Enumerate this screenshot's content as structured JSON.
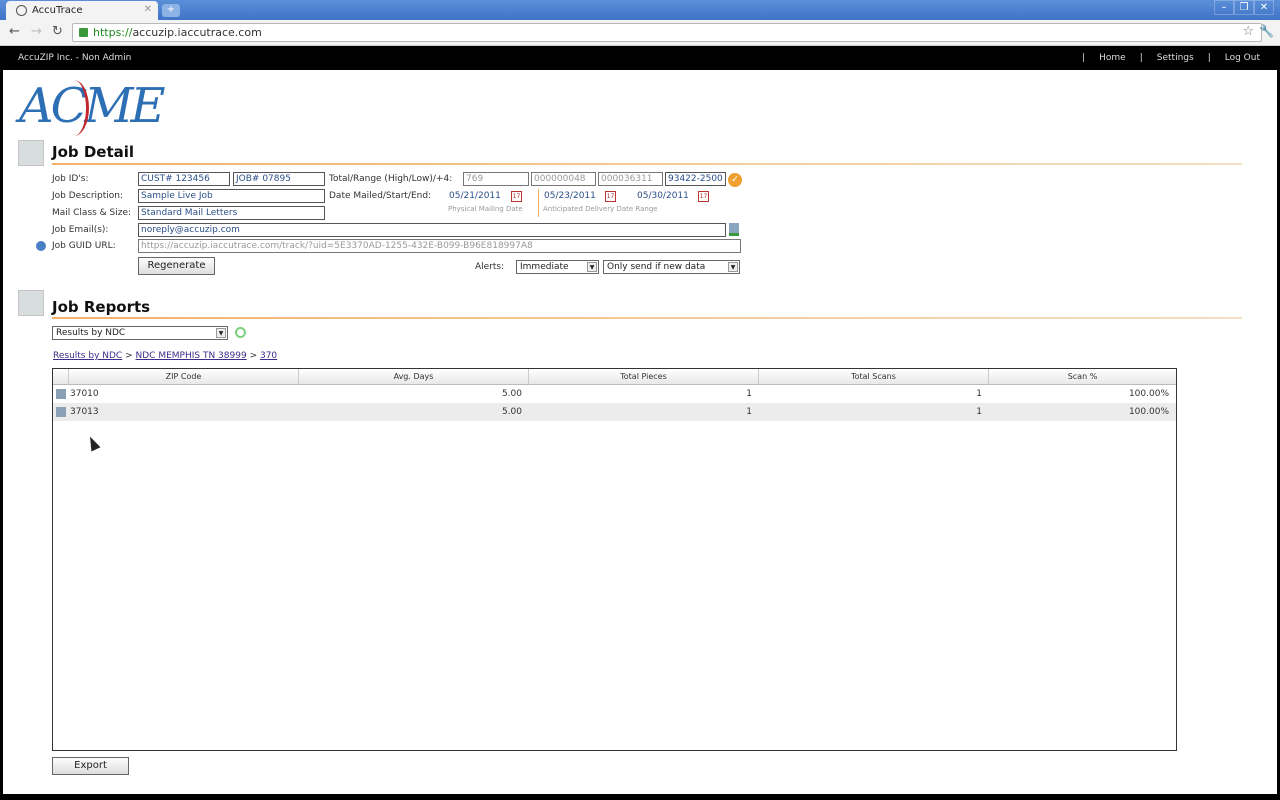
{
  "browser": {
    "tab_title": "AccuTrace",
    "url_scheme": "https://",
    "url_host": "accuzip.iaccutrace.com",
    "new_tab_label": "+"
  },
  "topnav": {
    "brand": "AccuZIP Inc. - Non Admin",
    "links": [
      "Home",
      "Settings",
      "Log Out"
    ],
    "separator": "|"
  },
  "logo": {
    "text": "ACME"
  },
  "job_detail": {
    "title": "Job Detail",
    "labels": {
      "job_ids": "Job ID's:",
      "job_description": "Job Description:",
      "mail_class": "Mail Class & Size:",
      "job_email": "Job Email(s):",
      "guid_url": "Job GUID URL:",
      "total_range": "Total/Range (High/Low)/+4:",
      "date_mailed": "Date Mailed/Start/End:",
      "alerts": "Alerts:"
    },
    "cust_id": "CUST# 123456",
    "job_id": "JOB# 07895",
    "description": "Sample Live Job",
    "mail_class": "Standard Mail Letters",
    "email": "noreply@accuzip.com",
    "guid_url": "https://accuzip.iaccutrace.com/track/?uid=5E3370AD-1255-432E-B099-B96E818997A8",
    "total": "769",
    "range_low": "000000048",
    "range_high": "000036311",
    "plus4": "93422-2500",
    "date_mailed": "05/21/2011",
    "date_start": "05/23/2011",
    "date_end": "05/30/2011",
    "hint_mailing": "Physical Mailing Date",
    "hint_delivery": "Anticipated Delivery Date Range",
    "calendar_label": "17",
    "regenerate_label": "Regenerate",
    "alert_frequency": "Immediate",
    "alert_condition": "Only send if new data"
  },
  "job_reports": {
    "title": "Job Reports",
    "report_type": "Results by NDC",
    "breadcrumb": [
      "Results by NDC",
      "NDC MEMPHIS TN 38999",
      "370"
    ],
    "breadcrumb_sep": ">",
    "columns": [
      "ZIP Code",
      "Avg. Days",
      "Total Pieces",
      "Total Scans",
      "Scan %"
    ],
    "rows": [
      {
        "zip": "37010",
        "avg_days": "5.00",
        "total_pieces": "1",
        "total_scans": "1",
        "scan_pct": "100.00%"
      },
      {
        "zip": "37013",
        "avg_days": "5.00",
        "total_pieces": "1",
        "total_scans": "1",
        "scan_pct": "100.00%"
      }
    ],
    "export_label": "Export"
  },
  "colors": {
    "accent_rule": "#f3b267",
    "link": "#3c2d8a",
    "field_text": "#2a4f8a"
  }
}
